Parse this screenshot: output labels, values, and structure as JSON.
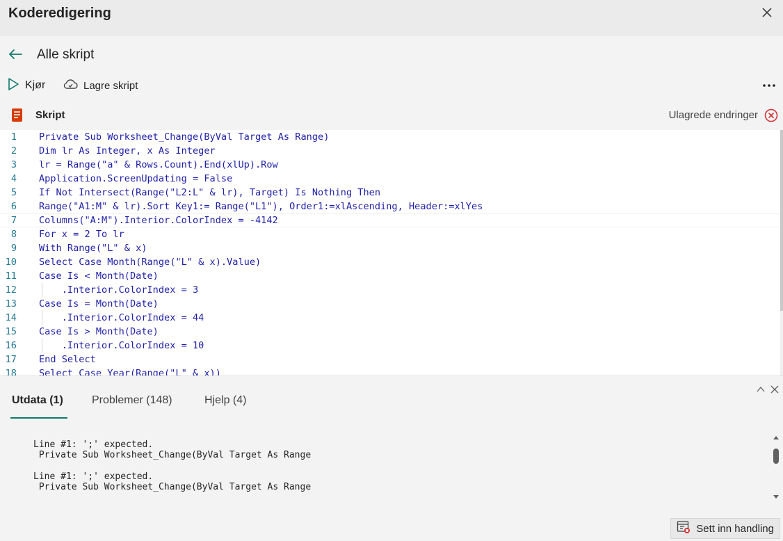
{
  "window": {
    "title": "Koderedigering"
  },
  "nav": {
    "title": "Alle skript"
  },
  "toolbar": {
    "run_label": "Kjør",
    "save_label": "Lagre skript"
  },
  "script": {
    "label": "Skript",
    "status": "Ulagrede endringer"
  },
  "editor": {
    "active_line": 7,
    "lines": [
      {
        "n": "1",
        "text": "Private Sub Worksheet_Change(ByVal Target As Range)"
      },
      {
        "n": "2",
        "text": "Dim lr As Integer, x As Integer"
      },
      {
        "n": "3",
        "text": "lr = Range(\"a\" & Rows.Count).End(xlUp).Row"
      },
      {
        "n": "4",
        "text": "Application.ScreenUpdating = False"
      },
      {
        "n": "5",
        "text": "If Not Intersect(Range(\"L2:L\" & lr), Target) Is Nothing Then"
      },
      {
        "n": "6",
        "text": "Range(\"A1:M\" & lr).Sort Key1:= Range(\"L1\"), Order1:=xlAscending, Header:=xlYes"
      },
      {
        "n": "7",
        "text": "Columns(\"A:M\").Interior.ColorIndex = -4142"
      },
      {
        "n": "8",
        "text": "For x = 2 To lr"
      },
      {
        "n": "9",
        "text": "With Range(\"L\" & x)"
      },
      {
        "n": "10",
        "text": "Select Case Month(Range(\"L\" & x).Value)"
      },
      {
        "n": "11",
        "text": "Case Is < Month(Date)"
      },
      {
        "n": "12",
        "text": "    .Interior.ColorIndex = 3"
      },
      {
        "n": "13",
        "text": "Case Is = Month(Date)"
      },
      {
        "n": "14",
        "text": "    .Interior.ColorIndex = 44"
      },
      {
        "n": "15",
        "text": "Case Is > Month(Date)"
      },
      {
        "n": "16",
        "text": "    .Interior.ColorIndex = 10"
      },
      {
        "n": "17",
        "text": "End Select"
      },
      {
        "n": "18",
        "text": "Select Case Year(Range(\"L\" & x))"
      }
    ]
  },
  "panel": {
    "tabs": [
      {
        "label": "Utdata (1)"
      },
      {
        "label": "Problemer (148)"
      },
      {
        "label": "Hjelp (4)"
      }
    ],
    "output": [
      "Line #1: ';' expected.",
      " Private Sub Worksheet_Change(ByVal Target As Range",
      "",
      "Line #1: ';' expected.",
      " Private Sub Worksheet_Change(ByVal Target As Range",
      "",
      "Line #1: ';' expected."
    ]
  },
  "footer": {
    "insert_label": "Sett inn handling"
  },
  "colors": {
    "accent": "#0f7b6c",
    "error": "#d13438",
    "script_icon": "#d83b01",
    "keyword": "#1f1fa8"
  }
}
